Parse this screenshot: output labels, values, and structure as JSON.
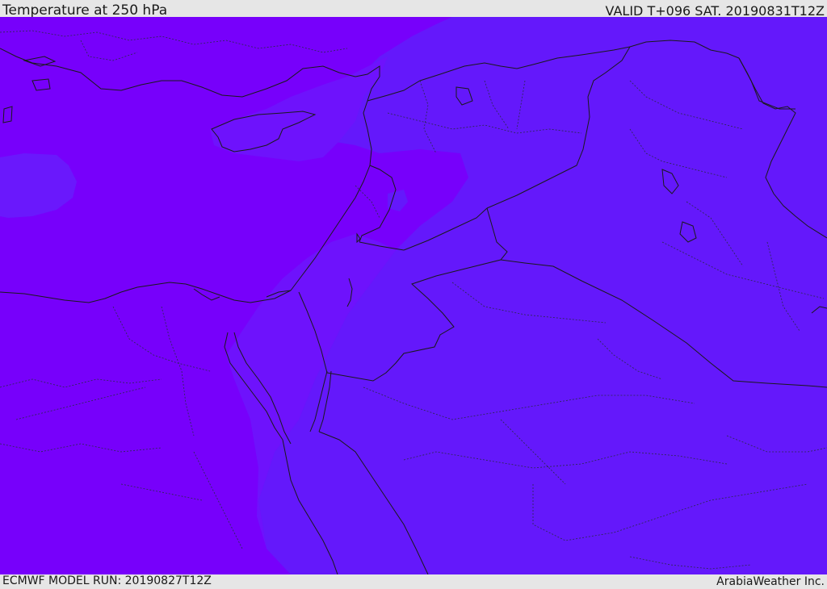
{
  "header": {
    "title": "Temperature at 250 hPa",
    "valid": "VALID T+096 SAT. 20190831T12Z"
  },
  "footer": {
    "model_run": "ECMWF MODEL RUN: 20190827T12Z",
    "credit": "ArabiaWeather Inc."
  },
  "colors": {
    "warm_field": "#7700fb",
    "mid_field": "#6a18fc",
    "cool_field": "#6418fb",
    "coastline": "#1a1a1a",
    "border": "#1a1a1a",
    "province_border": "#2a2a4a"
  }
}
